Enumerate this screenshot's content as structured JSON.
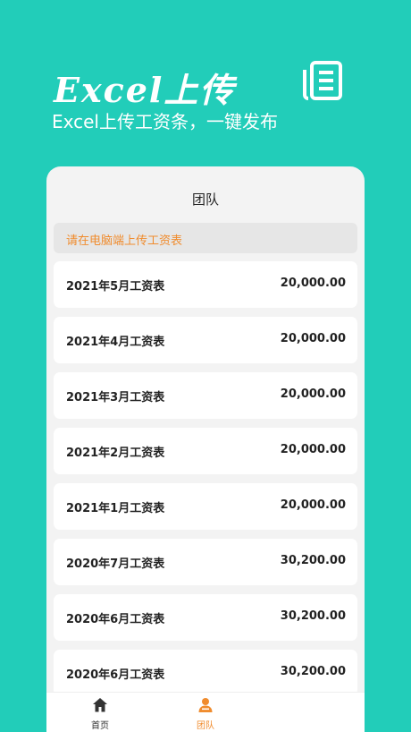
{
  "hero": {
    "title": "Excel上传",
    "subtitle": "Excel上传工资条，一键发布",
    "icon": "document-list-icon"
  },
  "card": {
    "title": "团队",
    "notice": "请在电脑端上传工资表"
  },
  "records": [
    {
      "name": "2021年5月工资表",
      "amount": "20,000.00"
    },
    {
      "name": "2021年4月工资表",
      "amount": "20,000.00"
    },
    {
      "name": "2021年3月工资表",
      "amount": "20,000.00"
    },
    {
      "name": "2021年2月工资表",
      "amount": "20,000.00"
    },
    {
      "name": "2021年1月工资表",
      "amount": "20,000.00"
    },
    {
      "name": "2020年7月工资表",
      "amount": "30,200.00"
    },
    {
      "name": "2020年6月工资表",
      "amount": "30,200.00"
    },
    {
      "name": "2020年6月工资表",
      "amount": "30,200.00"
    }
  ],
  "tabbar": {
    "home_label": "首页",
    "team_label": "团队",
    "active_color": "#f08c2e"
  },
  "colors": {
    "background": "#22cdb9",
    "accent": "#f08c2e"
  }
}
